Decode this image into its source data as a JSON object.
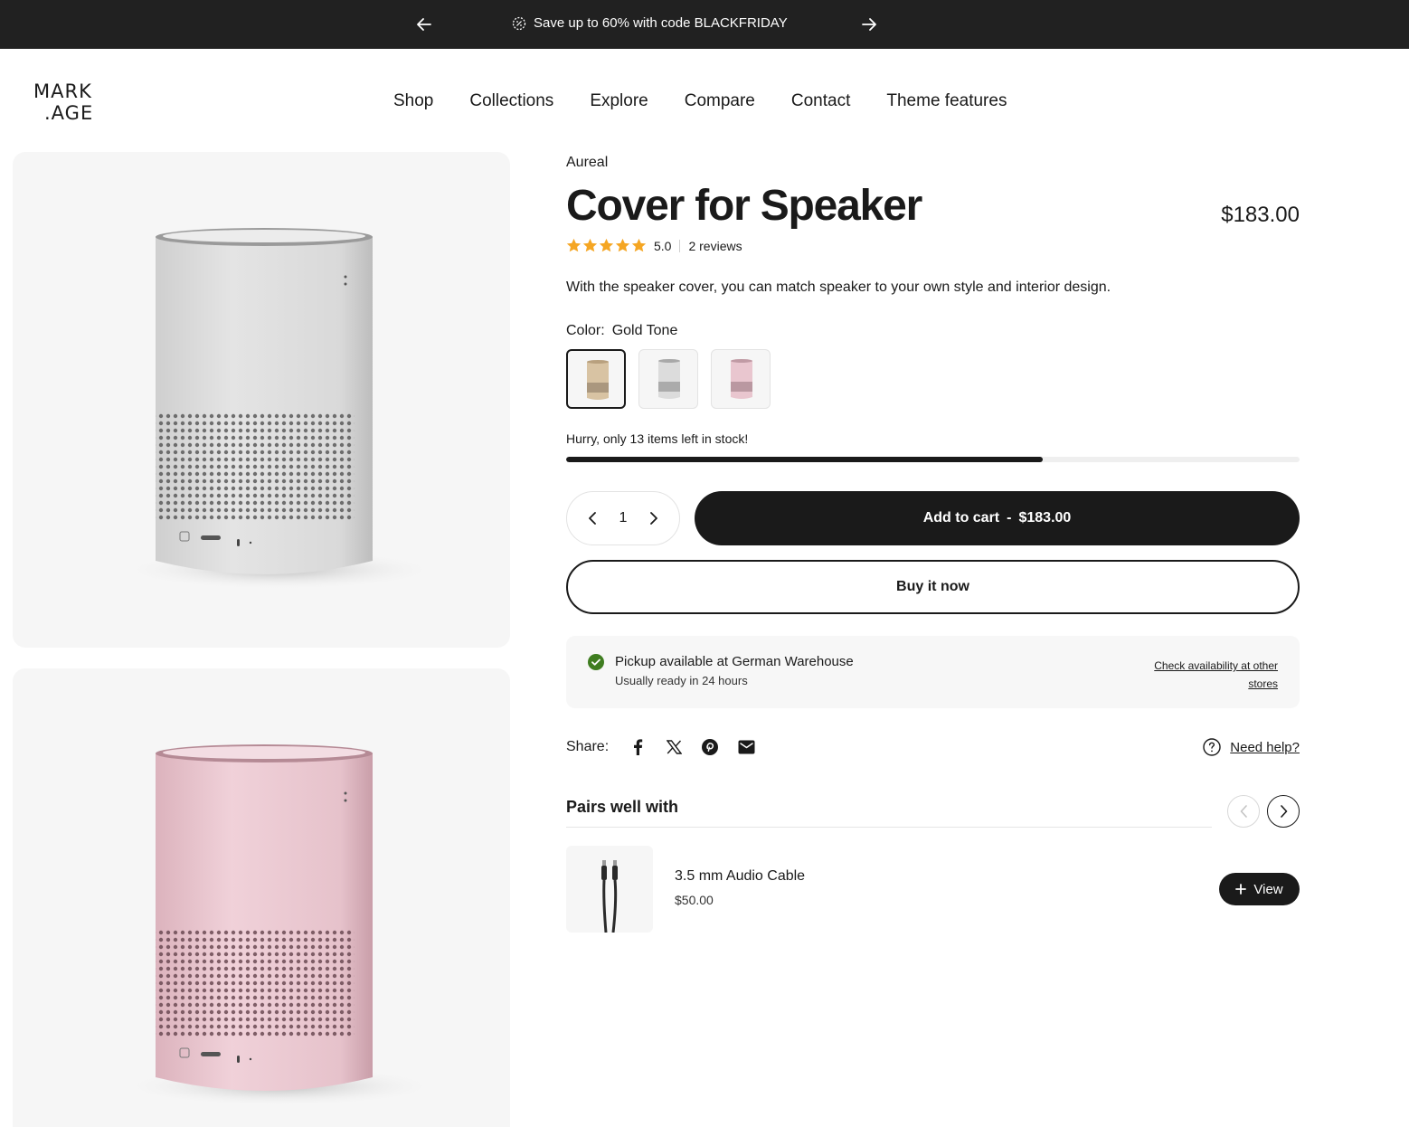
{
  "announcement": {
    "text": "Save up to 60% with code BLACKFRIDAY",
    "icon": "sale-tag-icon",
    "prev_icon": "arrow-left-icon",
    "next_icon": "arrow-right-icon",
    "background": "#212121"
  },
  "header": {
    "logo_text": [
      "MARK",
      ".AGE"
    ],
    "nav": [
      "Shop",
      "Collections",
      "Explore",
      "Compare",
      "Contact",
      "Theme features"
    ]
  },
  "product": {
    "vendor": "Aureal",
    "title": "Cover for Speaker",
    "price": "$183.00",
    "rating": {
      "score": "5.0",
      "stars": 5,
      "reviews": "2 reviews",
      "star_color": "#f5a623"
    },
    "description": "With the speaker cover, you can match speaker to your own style and interior design.",
    "color": {
      "label": "Color:",
      "selected": "Gold Tone",
      "swatches": [
        {
          "name": "Gold Tone",
          "color": "#d8c3a3"
        },
        {
          "name": "Silver",
          "color": "#dcdcdc"
        },
        {
          "name": "Pink",
          "color": "#e9c6cf"
        }
      ]
    },
    "stock": {
      "text": "Hurry, only 13 items left in stock!",
      "level_percent": 65
    },
    "quantity": "1",
    "add_to_cart": {
      "label": "Add to cart",
      "separator": "-",
      "price": "$183.00"
    },
    "buy_now": "Buy it now",
    "pickup": {
      "title": "Pickup available at German Warehouse",
      "subtitle": "Usually ready in 24 hours",
      "link": "Check availability at other stores",
      "icon_color": "#3f7d20"
    },
    "share": {
      "label": "Share:",
      "icons": [
        "facebook-icon",
        "x-icon",
        "pinterest-icon",
        "email-icon"
      ]
    },
    "help": "Need help?"
  },
  "pairs": {
    "title": "Pairs well with",
    "items": [
      {
        "name": "3.5 mm Audio Cable",
        "price": "$50.00",
        "button": "View"
      }
    ]
  },
  "gallery": {
    "images": [
      {
        "name": "speaker-silver",
        "color": "#dedede"
      },
      {
        "name": "speaker-pink",
        "color": "#ecc8d2"
      }
    ]
  }
}
